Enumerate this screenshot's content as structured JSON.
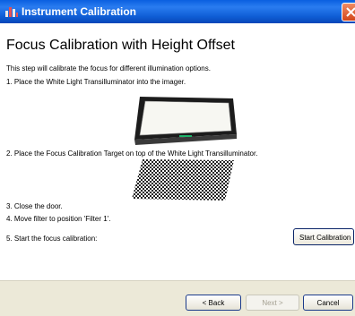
{
  "window": {
    "title": "Instrument Calibration"
  },
  "page": {
    "heading": "Focus Calibration with Height Offset",
    "intro": "This step will calibrate the focus for different illumination options.",
    "steps": [
      "1. Place the White Light Transilluminator into the imager.",
      "2. Place the Focus Calibration Target on top of the White Light Transilluminator.",
      "3. Close the door.",
      "4. Move filter to position 'Filter 1'.",
      "5. Start the focus calibration:"
    ],
    "start_button": "Start Calibration"
  },
  "footer": {
    "back_label": "< Back",
    "next_label": "Next >",
    "cancel_label": "Cancel"
  },
  "icons": {
    "title_icon": "bar-chart-icon",
    "close_icon": "close-icon"
  },
  "colors": {
    "titlebar": "#0a5fe0",
    "close_button": "#d2461a",
    "footer_bg": "#ece9d8"
  }
}
